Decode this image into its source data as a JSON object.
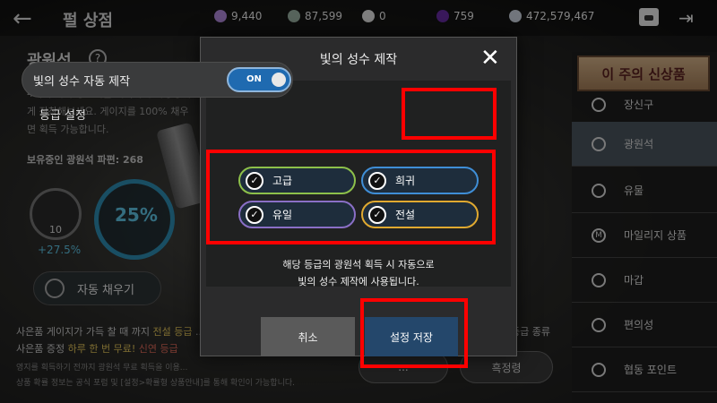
{
  "topbar": {
    "title": "펄 상점",
    "currencies": [
      {
        "name": "purple-gem",
        "value": "9,440",
        "color": "#b48ce0"
      },
      {
        "name": "silver-coin",
        "value": "87,599",
        "color": "#9fb7a8"
      },
      {
        "name": "pearl",
        "value": "0",
        "color": "#e8e8e8"
      },
      {
        "name": "dark-orb",
        "value": "759",
        "color": "#6b2fa8"
      },
      {
        "name": "silver",
        "value": "472,579,467",
        "color": "#cfd8e3"
      }
    ]
  },
  "background": {
    "section_title": "광원석",
    "desc": "4개 부위의 광원석을 획득하여 흑정령에게 장착해보세요. 게이지를 100% 채우면 획득 가능합니다.",
    "owned_label": "보유중인 광원석 파편: 268",
    "gauge_small_value": "10",
    "gauge_small_pct": "+27.5%",
    "gauge_big_pct": "25%",
    "autofill_label": "자동 채우기",
    "notice1_a": "사은품 게이지가 가득 찰 때 까지",
    "notice1_b": "전설 등급",
    "notice1_c": "...",
    "notice1_tail": "등급 종류",
    "notice2_a": "사은품 증정",
    "notice2_b": "하루 한 번 무료!",
    "notice2_c": "신연 등급",
    "notice3": "영지를 획득하기 전까지 광원석 무료 획득을 이용...",
    "notice4": "상품 확률 정보는 공식 포럼 및 [설정>확률형 상품안내]를 통해 확인이 가능합니다.",
    "bottom_btn_1": "...",
    "bottom_btn_2": "...",
    "bottom_btn_3": "흑정령"
  },
  "sidebar": {
    "featured": "이 주의 신상품",
    "items": [
      {
        "label": "장신구",
        "icon": "ring-icon"
      },
      {
        "label": "광원석",
        "icon": "feather-icon"
      },
      {
        "label": "유물",
        "icon": "gear-icon"
      },
      {
        "label": "마일리지 상품",
        "icon": "mileage-icon"
      },
      {
        "label": "마갑",
        "icon": "horse-icon"
      },
      {
        "label": "편의성",
        "icon": "potion-icon"
      },
      {
        "label": "협동 포인트",
        "icon": "handshake-icon"
      }
    ]
  },
  "modal": {
    "title": "빛의 성수 제작",
    "auto_label": "빛의 성수 자동 제작",
    "toggle_state": "ON",
    "grade_title": "등급 설정",
    "grades": [
      {
        "label": "고급",
        "color": "#8dc04a"
      },
      {
        "label": "희귀",
        "color": "#3f8ed6"
      },
      {
        "label": "유일",
        "color": "#8a6fc6"
      },
      {
        "label": "전설",
        "color": "#e0a930"
      }
    ],
    "info_line1": "해당 등급의 광원석 획득 시 자동으로",
    "info_line2": "빛의 성수 제작에 사용됩니다.",
    "cancel_label": "취소",
    "save_label": "설정 저장"
  }
}
